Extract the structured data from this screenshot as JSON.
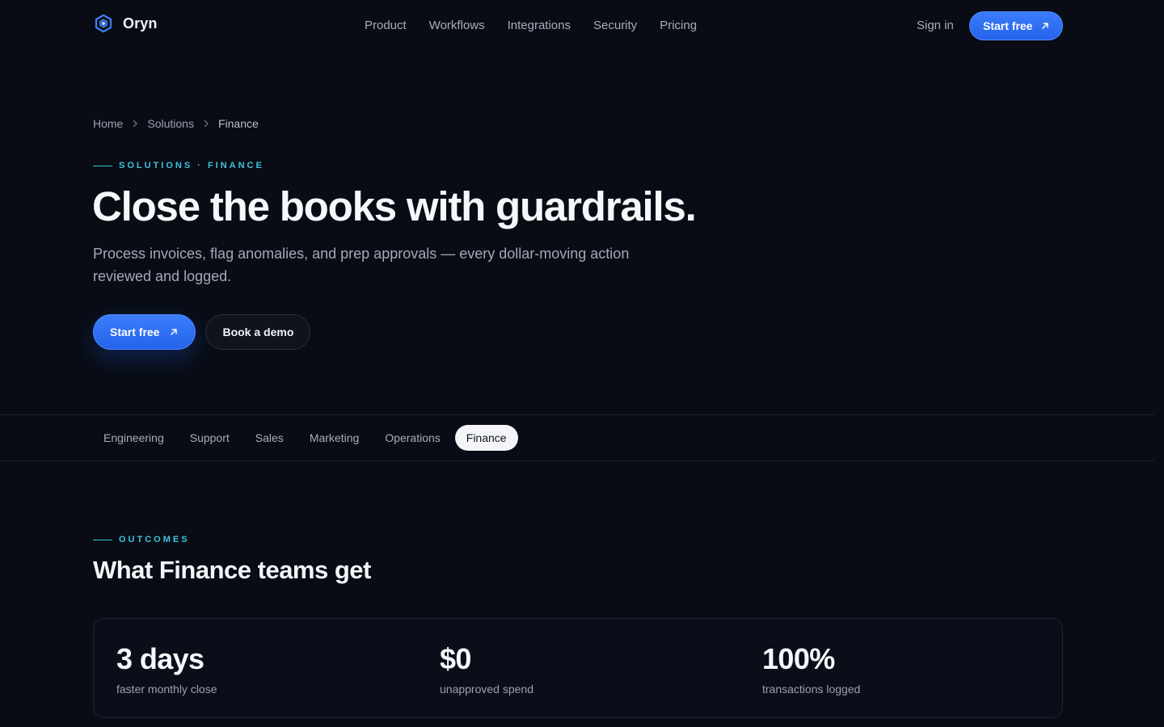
{
  "nav": {
    "brand": "Oryn",
    "links": [
      "Product",
      "Workflows",
      "Integrations",
      "Security",
      "Pricing"
    ],
    "sign_in": "Sign in",
    "cta": "Start free"
  },
  "hero": {
    "breadcrumb": [
      "Home",
      "Solutions",
      "Finance"
    ],
    "eyebrow": "SOLUTIONS · FINANCE",
    "title": "Close the books with guardrails.",
    "subtitle": "Process invoices, flag anomalies, and prep approvals — every dollar-moving action reviewed and logged.",
    "primary_cta": "Start free",
    "secondary_cta": "Book a demo"
  },
  "tabs": {
    "items": [
      "Engineering",
      "Support",
      "Sales",
      "Marketing",
      "Operations",
      "Finance"
    ],
    "active": "Finance"
  },
  "outcomes": {
    "eyebrow": "OUTCOMES",
    "title": "What Finance teams get",
    "stats": [
      {
        "value": "3 days",
        "label": "faster monthly close"
      },
      {
        "value": "$0",
        "label": "unapproved spend"
      },
      {
        "value": "100%",
        "label": "transactions logged"
      }
    ]
  },
  "colors": {
    "background": "#090c15",
    "accent": "#3b7dfb",
    "eyebrow": "#3fc3dc"
  },
  "icons": {
    "brand": "hexagon-logo-icon",
    "cta_arrow": "arrow-up-right-icon",
    "breadcrumb_separator": "chevron-right-icon"
  }
}
